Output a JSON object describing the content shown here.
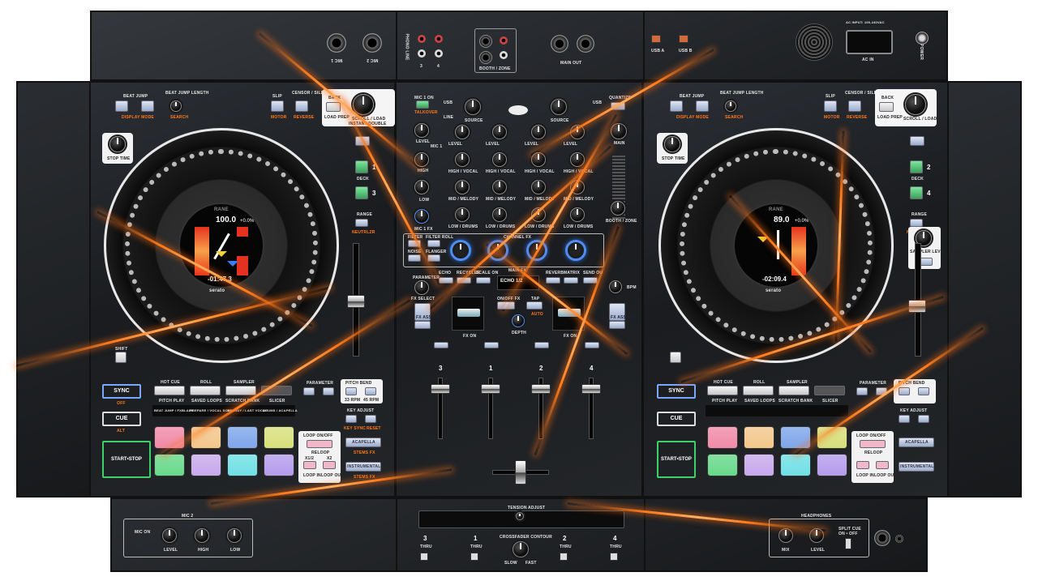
{
  "rear": {
    "mic1": "MIC 1",
    "mic2": "MIC 2",
    "phono_line": "PHONO LINE",
    "ch3": "3",
    "ch4": "4",
    "booth_zone": "BOOTH / ZONE",
    "main_out": "MAIN OUT",
    "usb_a": "USB A",
    "usb_b": "USB B",
    "ac_in": "AC IN",
    "power": "POWER",
    "ac_rating": "AC INPUT: 100-240VAC"
  },
  "left_deck": {
    "beat_jump": "BEAT JUMP",
    "display_mode": "DISPLAY MODE",
    "beat_jump_length": "BEAT JUMP LENGTH",
    "search": "SEARCH",
    "slip": "SLIP",
    "motor": "MOTOR",
    "censor": "CENSOR / SILENT CUE",
    "reverse": "REVERSE",
    "back": "BACK",
    "load_prep": "LOAD PREP",
    "scroll_load": "SCROLL / LOAD",
    "instant_double": "INSTANT DOUBLE",
    "stop_time": "STOP TIME",
    "deck": "DECK",
    "deck_a": "1",
    "deck_b": "3",
    "range": "RANGE",
    "neutrlzr": "NEUTRLZR",
    "brand": "RANE",
    "bpm": "100.0",
    "pitch": "+0.0%",
    "time": "-01:47.3",
    "serato": "serato",
    "shift": "SHIFT",
    "sync": "SYNC",
    "off": "OFF",
    "cue": "CUE",
    "cue_sub": "ALT",
    "start_stop": "START•STOP",
    "mode_row1": [
      "HOT CUE",
      "ROLL",
      "SAMPLER",
      ""
    ],
    "mode_row2": [
      "PITCH PLAY",
      "SAVED LOOPS",
      "SCRATCH BANK",
      "SLICER"
    ],
    "mode_row3": [
      "BEAT JUMP / FXBLADE",
      "PREPARE / VOCAL SCENE",
      "MELODY / LAST VOCAL",
      "DRUMS / ACAPELLA"
    ],
    "parameter": "PARAMETER",
    "pitch_bend": "PITCH BEND",
    "bend_minus": "33 RPM",
    "bend_plus": "45 RPM",
    "key_adjust": "KEY ADJUST",
    "key_sync": "KEY SYNC",
    "reset": "RESET",
    "loop_onoff": "LOOP ON/OFF",
    "reloop": "RELOOP",
    "half": "x1/2",
    "double": "x2",
    "loop_in": "LOOP IN",
    "loop_out": "LOOP OUT",
    "acapella": "ACAPELLA",
    "stems_fx": "STEMS FX",
    "instrumental": "INSTRUMENTAL",
    "stems_fx2": "STEMS FX"
  },
  "right_deck": {
    "deck_a": "2",
    "deck_b": "4",
    "bpm": "89.0",
    "pitch": "+0.0%",
    "time": "-02:09.4",
    "sampler_level": "SAMPLER LEVEL",
    "sampler_sub": "MODE/FX"
  },
  "mixer": {
    "mic_on": "MIC 1 ON",
    "mic_talkover": "TALKOVER",
    "usb": "USB",
    "line": "LINE",
    "source": "SOURCE",
    "main": "MAIN",
    "quantize": "QUANTIZE",
    "level": "LEVEL",
    "mic1": "MIC 1",
    "high": "HIGH",
    "low": "LOW",
    "high_vocal": "HIGH / VOCAL",
    "mid_melody": "MID / MELODY",
    "low_drums": "LOW / DRUMS",
    "mic_fx": "MIC 1 FX",
    "booth_zone": "BOOTH / ZONE",
    "filter": "FILTER",
    "filter_roll": "FILTER ROLL",
    "noise": "NOISE",
    "flanger": "FLANGER",
    "channel_fx": "CHANNEL FX",
    "main_fx": "MAIN FX",
    "fx_names": [
      "ECHO",
      "RECYCLER",
      "SCALE ON",
      "REVERB",
      "MATRIX",
      "SEND OU"
    ],
    "parameter": "PARAMETER",
    "fx_select": "FX SELECT",
    "fx_assign": "FX ASSIGN",
    "fx_on": "FX ON",
    "on_off": "ON/OFF FX",
    "tap": "TAP",
    "auto": "AUTO",
    "depth": "DEPTH",
    "bpm": "BPM",
    "lcd": "ECHO 1/2",
    "channels": [
      "3",
      "1",
      "2",
      "4"
    ],
    "fader_label": [
      "3/4",
      "1/2",
      "1/2",
      "3/4"
    ],
    "tension": "TENSION ADJUST",
    "contour": "CROSSFADER CONTOUR",
    "slow": "SLOW",
    "fast": "FAST",
    "thru": "THRU"
  },
  "front": {
    "mic2": "MIC 2",
    "mic_on": "MIC ON",
    "level": "LEVEL",
    "high": "HIGH",
    "low": "LOW",
    "headphones": "HEADPHONES",
    "cue": "CUE",
    "main": "MAIN",
    "mix": "MIX",
    "split_cue": "SPLIT CUE",
    "on_off": "ON • OFF"
  },
  "pads": [
    "#f08aa8",
    "#f3c78c",
    "#7fa6ea",
    "#d7e07c",
    "#67d98a",
    "#c8a9ec",
    "#6fe0e6",
    "#b59cec"
  ],
  "colors": {
    "accent": "#ff7a1a",
    "blue": "#4f8df0",
    "green": "#3aa15a"
  }
}
